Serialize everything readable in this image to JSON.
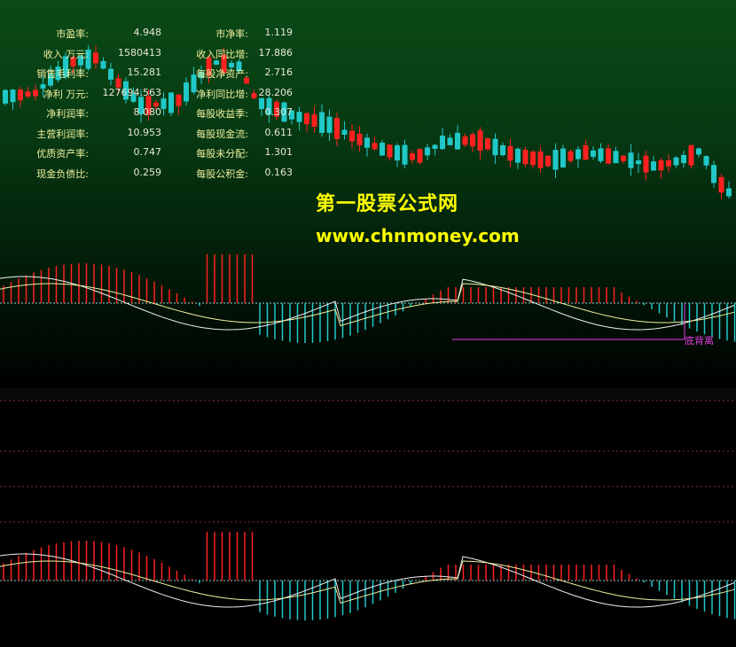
{
  "financials": [
    {
      "label1": "市盈率:",
      "value1": "4.948",
      "label2": "市净率:",
      "value2": "1.119"
    },
    {
      "label1": "收入 万元:",
      "value1": "1580413",
      "label2": "收入同比增:",
      "value2": "17.886"
    },
    {
      "label1": "销售毛利率:",
      "value1": "15.281",
      "label2": "每股净资产:",
      "value2": "2.716"
    },
    {
      "label1": "净利 万元:",
      "value1": "127694.563",
      "label2": "净利同比增:",
      "value2": "28.206"
    },
    {
      "label1": "净利润率:",
      "value1": "8.080",
      "label2": "每股收益季:",
      "value2": "0.307"
    },
    {
      "label1": "主营利润率:",
      "value1": "10.953",
      "label2": "每股现金流:",
      "value2": "0.611"
    },
    {
      "label1": "优质资产率:",
      "value1": "0.747",
      "label2": "每股未分配:",
      "value2": "1.301"
    },
    {
      "label1": "现金负债比:",
      "value1": "0.259",
      "label2": "每股公积金:",
      "value2": "0.163"
    }
  ],
  "watermark": {
    "title": "第一股票公式网",
    "url": "www.chnmoney.com"
  },
  "annotation": {
    "divergence_label": "底背离"
  },
  "colors": {
    "up": "#ff2020",
    "down": "#20c8c8",
    "dif": "#f0f0f0",
    "dea": "#f0f0a0",
    "zero": "#90d0d0",
    "divergence": "#e040e0"
  }
}
